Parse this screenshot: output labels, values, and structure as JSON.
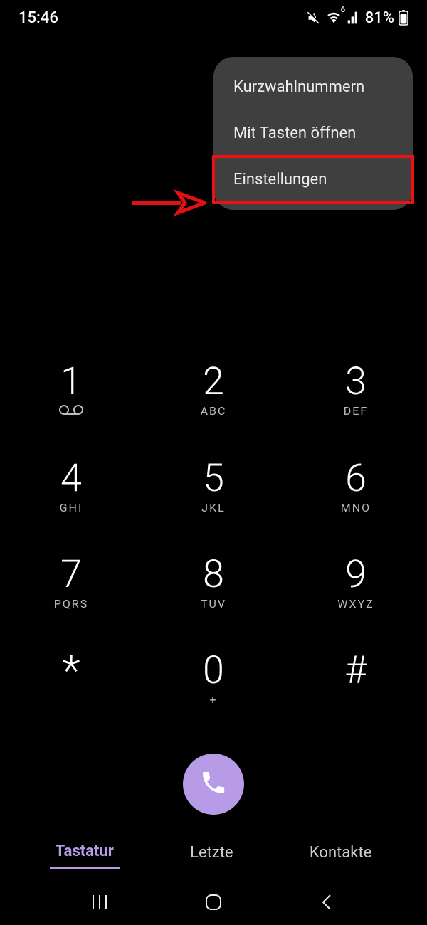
{
  "statusbar": {
    "time": "15:46",
    "battery_percent": "81%",
    "network_label": "6",
    "icons": {
      "mute": "mute-icon",
      "wifi": "wifi-icon",
      "signal": "signal-icon",
      "battery": "battery-icon"
    }
  },
  "popup": {
    "items": [
      {
        "label": "Kurzwahlnummern"
      },
      {
        "label": "Mit Tasten öffnen"
      },
      {
        "label": "Einstellungen"
      }
    ],
    "highlighted_index": 2
  },
  "annotation": {
    "highlight_color": "#e11012"
  },
  "keypad": {
    "rows": [
      [
        {
          "d": "1",
          "s": "voicemail"
        },
        {
          "d": "2",
          "s": "ABC"
        },
        {
          "d": "3",
          "s": "DEF"
        }
      ],
      [
        {
          "d": "4",
          "s": "GHI"
        },
        {
          "d": "5",
          "s": "JKL"
        },
        {
          "d": "6",
          "s": "MNO"
        }
      ],
      [
        {
          "d": "7",
          "s": "PQRS"
        },
        {
          "d": "8",
          "s": "TUV"
        },
        {
          "d": "9",
          "s": "WXYZ"
        }
      ],
      [
        {
          "d": "*",
          "s": ""
        },
        {
          "d": "0",
          "s": "+"
        },
        {
          "d": "#",
          "s": ""
        }
      ]
    ]
  },
  "accent_color": "#b79be6",
  "tabs": {
    "items": [
      {
        "label": "Tastatur",
        "active": true
      },
      {
        "label": "Letzte",
        "active": false
      },
      {
        "label": "Kontakte",
        "active": false
      }
    ]
  }
}
